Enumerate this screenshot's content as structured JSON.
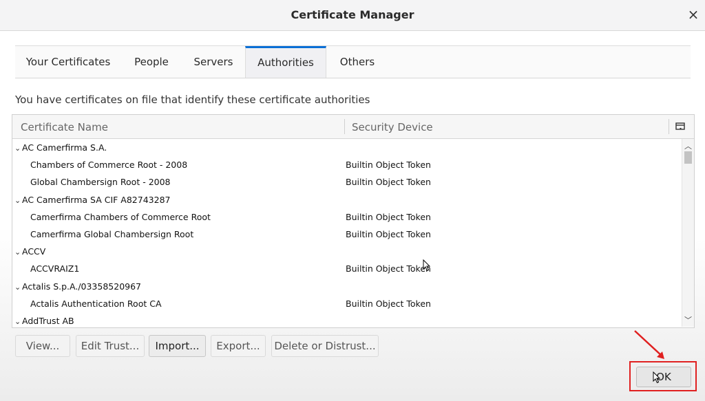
{
  "window": {
    "title": "Certificate Manager",
    "close_glyph": "×"
  },
  "tabs": [
    {
      "label": "Your Certificates",
      "active": false
    },
    {
      "label": "People",
      "active": false
    },
    {
      "label": "Servers",
      "active": false
    },
    {
      "label": "Authorities",
      "active": true
    },
    {
      "label": "Others",
      "active": false
    }
  ],
  "intro_text": "You have certificates on file that identify these certificate authorities",
  "tree": {
    "columns": {
      "name": "Certificate Name",
      "device": "Security Device",
      "picker_icon": "column-picker-icon"
    },
    "rows": [
      {
        "type": "group",
        "name": "AC Camerfirma S.A.",
        "device": ""
      },
      {
        "type": "child",
        "name": "Chambers of Commerce Root - 2008",
        "device": "Builtin Object Token"
      },
      {
        "type": "child",
        "name": "Global Chambersign Root - 2008",
        "device": "Builtin Object Token"
      },
      {
        "type": "group",
        "name": "AC Camerfirma SA CIF A82743287",
        "device": ""
      },
      {
        "type": "child",
        "name": "Camerfirma Chambers of Commerce Root",
        "device": "Builtin Object Token"
      },
      {
        "type": "child",
        "name": "Camerfirma Global Chambersign Root",
        "device": "Builtin Object Token"
      },
      {
        "type": "group",
        "name": "ACCV",
        "device": ""
      },
      {
        "type": "child",
        "name": "ACCVRAIZ1",
        "device": "Builtin Object Token"
      },
      {
        "type": "group",
        "name": "Actalis S.p.A./03358520967",
        "device": ""
      },
      {
        "type": "child",
        "name": "Actalis Authentication Root CA",
        "device": "Builtin Object Token"
      },
      {
        "type": "group",
        "name": "AddTrust AB",
        "device": ""
      }
    ],
    "twisty_glyph": "⌄"
  },
  "buttons": {
    "view": "View...",
    "edit_trust": "Edit Trust...",
    "import": "Import...",
    "export": "Export...",
    "delete": "Delete or Distrust...",
    "ok": "OK"
  },
  "colors": {
    "accent": "#0a6fd6",
    "highlight": "#e02020"
  }
}
